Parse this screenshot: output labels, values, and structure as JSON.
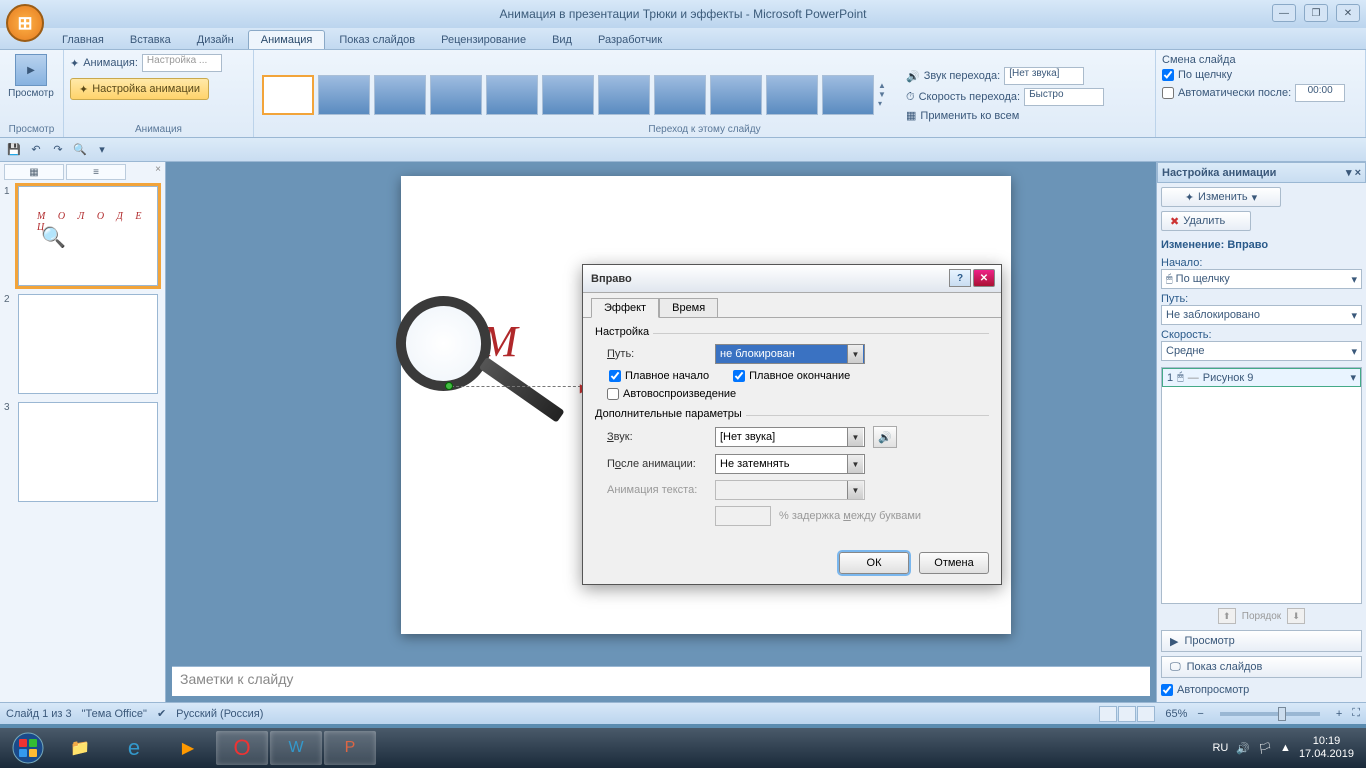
{
  "window": {
    "title": "Анимация в презентации Трюки и эффекты - Microsoft PowerPoint"
  },
  "ribbon": {
    "tabs": [
      "Главная",
      "Вставка",
      "Дизайн",
      "Анимация",
      "Показ слайдов",
      "Рецензирование",
      "Вид",
      "Разработчик"
    ],
    "active_tab": 3,
    "groups": {
      "preview": {
        "label": "Просмотр",
        "button": "Просмотр"
      },
      "animation": {
        "label": "Анимация",
        "anim_label": "Анимация:",
        "anim_value": "Настройка ...",
        "custom_btn": "Настройка анимации"
      },
      "transition": {
        "label": "Переход к этому слайду",
        "sound_label": "Звук перехода:",
        "sound_value": "[Нет звука]",
        "speed_label": "Скорость перехода:",
        "speed_value": "Быстро",
        "apply_all": "Применить ко всем"
      },
      "advance": {
        "label": "Смена слайда",
        "on_click": "По щелчку",
        "auto_after": "Автоматически после:",
        "auto_time": "00:00"
      }
    }
  },
  "slides_panel": {
    "outline_tab": "Структура",
    "slides_tab": "Слайды",
    "thumbs": [
      {
        "num": "1",
        "text": "М О Л О Д Е Ц",
        "selected": true,
        "has_mag": true
      },
      {
        "num": "2",
        "text": "",
        "selected": false,
        "has_mag": false
      },
      {
        "num": "3",
        "text": "",
        "selected": false,
        "has_mag": false
      }
    ]
  },
  "slide": {
    "badge": "1",
    "text": "М О Л"
  },
  "notes": {
    "placeholder": "Заметки к слайду"
  },
  "anim_pane": {
    "title": "Настройка анимации",
    "change_btn": "Изменить",
    "remove_btn": "Удалить",
    "section": "Изменение: Вправо",
    "start_label": "Начало:",
    "start_value": "По щелчку",
    "path_label": "Путь:",
    "path_value": "Не заблокировано",
    "speed_label": "Скорость:",
    "speed_value": "Средне",
    "item_num": "1",
    "item_name": "Рисунок 9",
    "order_label": "Порядок",
    "preview_btn": "Просмотр",
    "slideshow_btn": "Показ слайдов",
    "autopreview": "Автопросмотр"
  },
  "dialog": {
    "title": "Вправо",
    "tabs": [
      "Эффект",
      "Время"
    ],
    "active_tab": 0,
    "group_settings": "Настройка",
    "path_label": "Путь:",
    "path_value": "не блокирован",
    "smooth_start": "Плавное начало",
    "smooth_end": "Плавное окончание",
    "auto_reverse": "Автовоспроизведение",
    "group_extra": "Дополнительные параметры",
    "sound_label": "Звук:",
    "sound_value": "[Нет звука]",
    "after_label": "После анимации:",
    "after_value": "Не затемнять",
    "text_anim_label": "Анимация текста:",
    "delay_label": "% задержка между буквами",
    "ok": "ОК",
    "cancel": "Отмена"
  },
  "statusbar": {
    "slide_info": "Слайд 1 из 3",
    "theme": "\"Тема Office\"",
    "lang": "Русский (Россия)",
    "zoom": "65%"
  },
  "taskbar": {
    "lang": "RU",
    "time": "10:19",
    "date": "17.04.2019"
  }
}
